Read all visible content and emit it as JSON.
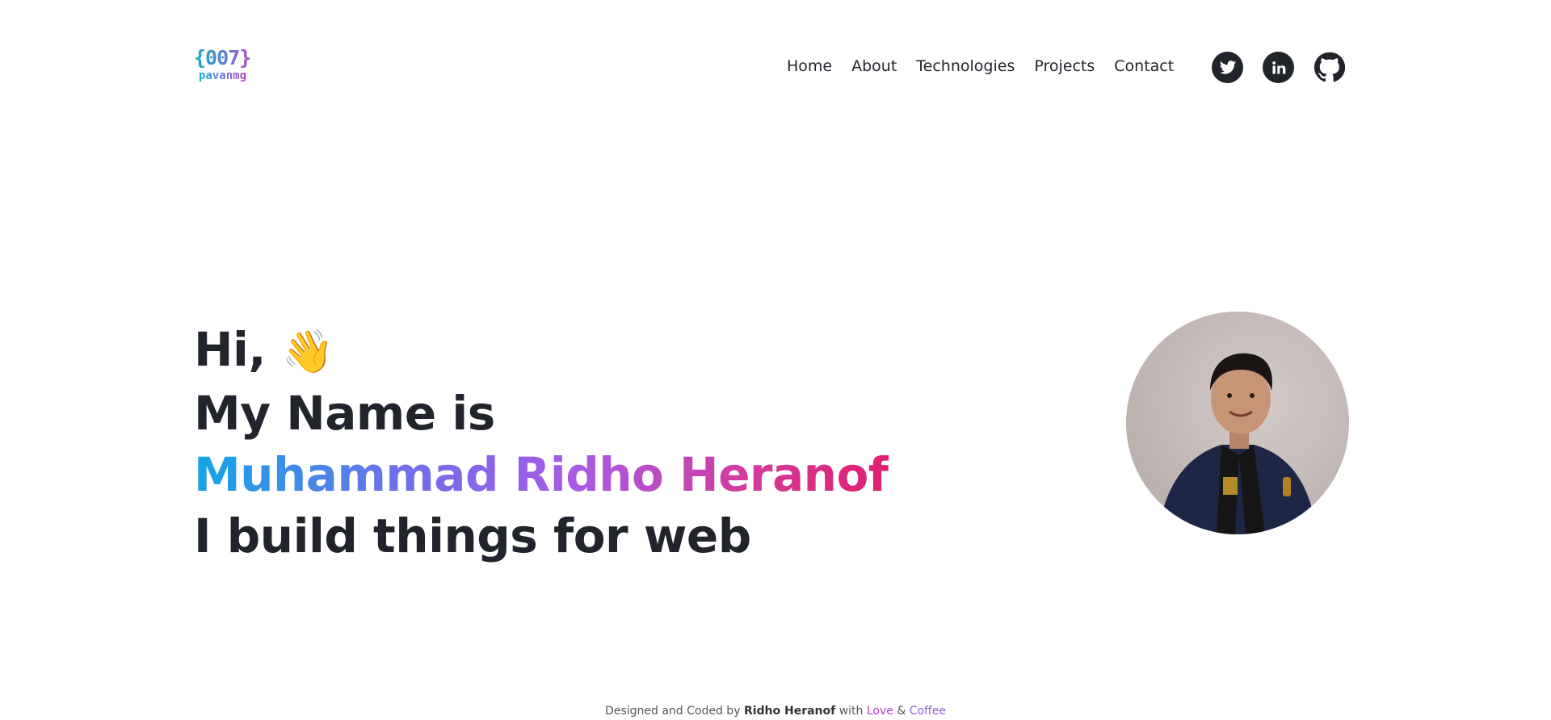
{
  "logo": {
    "mark": "{007}",
    "sub": "pavanmg"
  },
  "nav": {
    "items": [
      {
        "label": "Home"
      },
      {
        "label": "About"
      },
      {
        "label": "Technologies"
      },
      {
        "label": "Projects"
      },
      {
        "label": "Contact"
      }
    ]
  },
  "socials": [
    {
      "icon": "twitter-icon"
    },
    {
      "icon": "linkedin-icon"
    },
    {
      "icon": "github-icon"
    }
  ],
  "hero": {
    "greeting": "Hi,",
    "wave_emoji": "👋",
    "line2": "My Name is",
    "name": "Muhammad Ridho Heranof",
    "line4": "I build things for web"
  },
  "footer": {
    "prefix": "Designed and Coded by",
    "author": "Ridho Heranof",
    "with": "with",
    "love": "Love",
    "amp": "&",
    "coffee": "Coffee"
  },
  "colors": {
    "text": "#21252b",
    "gradient_start": "#13a6e6",
    "gradient_mid": "#a85ae6",
    "gradient_end": "#e01f6e"
  }
}
